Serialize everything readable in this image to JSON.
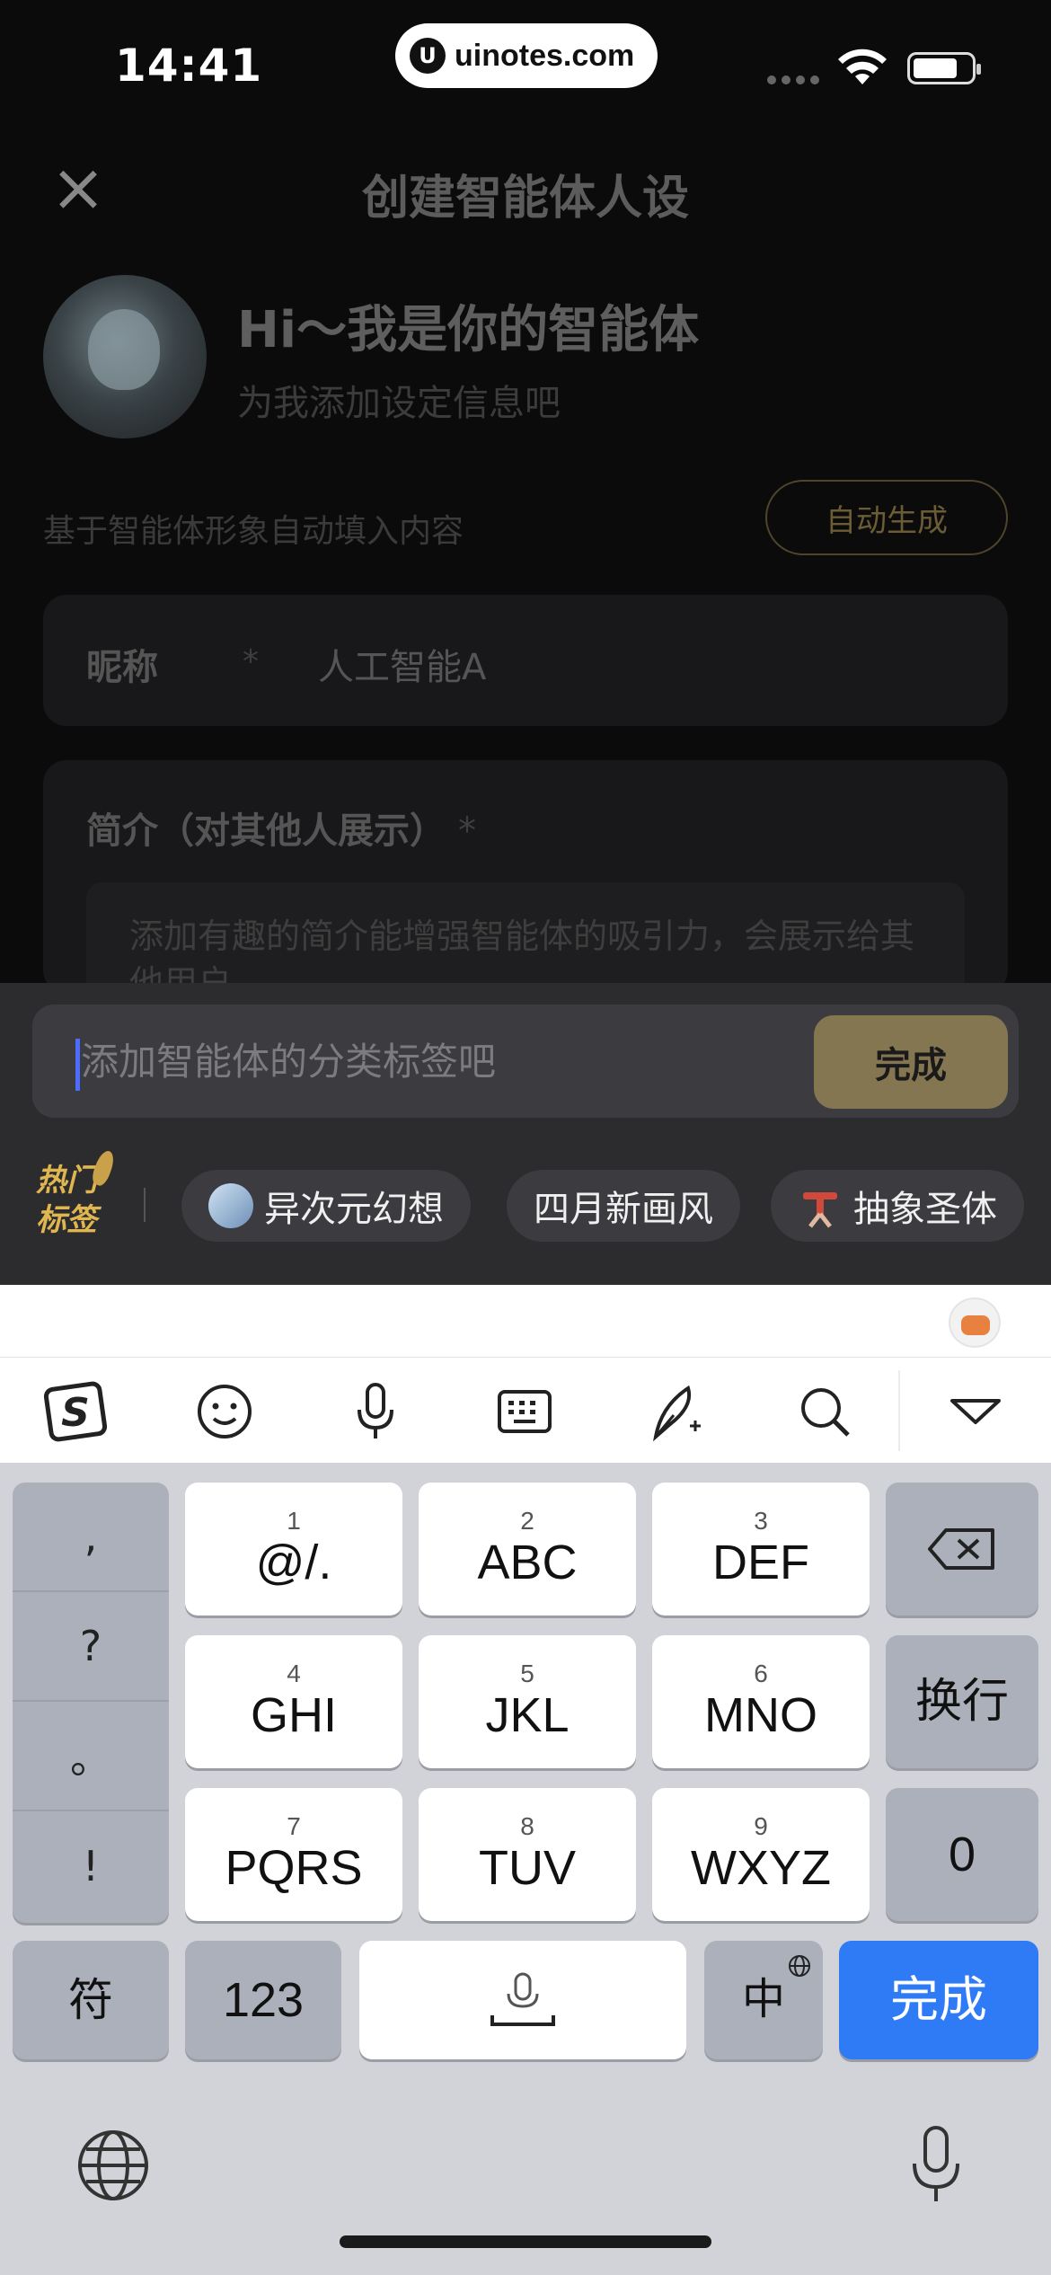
{
  "status": {
    "time": "14:41",
    "url": "uinotes.com"
  },
  "header": {
    "title": "创建智能体人设"
  },
  "intro": {
    "greeting": "Hi～我是你的智能体",
    "subtitle": "为我添加设定信息吧"
  },
  "auto": {
    "description": "基于智能体形象自动填入内容",
    "button": "自动生成"
  },
  "nickname": {
    "label": "昵称",
    "required": "*",
    "value": "人工智能A"
  },
  "bio": {
    "label": "简介（对其他人展示）",
    "required": "*",
    "placeholder": "添加有趣的简介能增强智能体的吸引力，会展示给其他用户"
  },
  "tags": {
    "input_placeholder": "添加智能体的分类标签吧",
    "done": "完成",
    "hot_label_line1": "热门",
    "hot_label_line2": "标签",
    "chips": [
      "异次元幻想",
      "四月新画风",
      "抽象圣体"
    ]
  },
  "keyboard": {
    "punct": [
      ",",
      "?",
      "。",
      "!"
    ],
    "keys": [
      {
        "num": "1",
        "label": "@/."
      },
      {
        "num": "2",
        "label": "ABC"
      },
      {
        "num": "3",
        "label": "DEF"
      },
      {
        "num": "4",
        "label": "GHI"
      },
      {
        "num": "5",
        "label": "JKL"
      },
      {
        "num": "6",
        "label": "MNO"
      },
      {
        "num": "7",
        "label": "PQRS"
      },
      {
        "num": "8",
        "label": "TUV"
      },
      {
        "num": "9",
        "label": "WXYZ"
      }
    ],
    "newline": "换行",
    "zero": "0",
    "symbols": "符",
    "numbers": "123",
    "lang": "中",
    "done": "完成"
  },
  "colors": {
    "accent_gold": "#857652",
    "keyboard_done": "#2f7bf5",
    "hot_label": "#e0b650"
  }
}
